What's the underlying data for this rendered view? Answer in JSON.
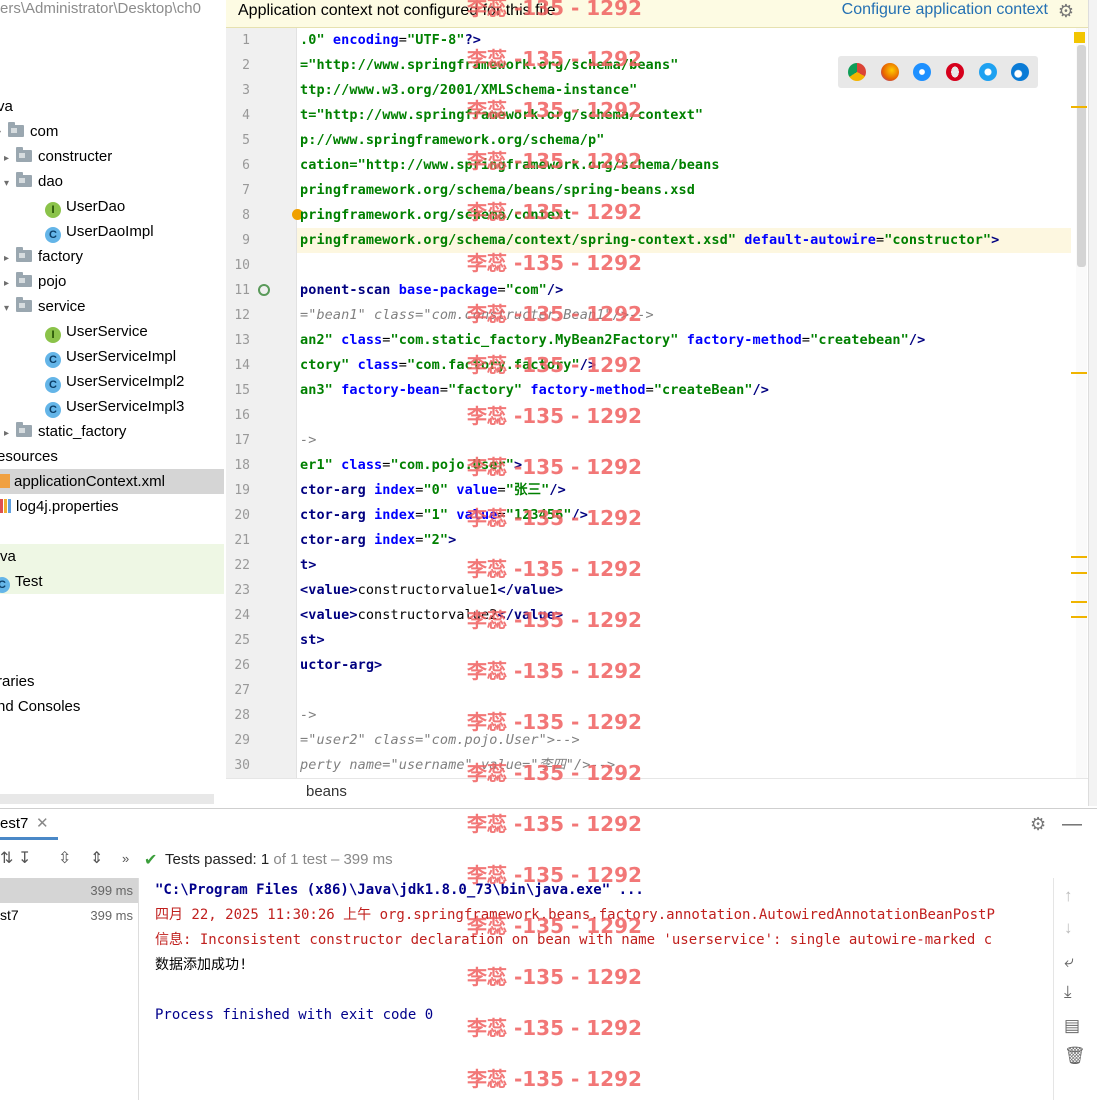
{
  "project_tree": {
    "header_path": "ers\\Administrator\\Desktop\\ch0",
    "items": [
      {
        "label": "va",
        "type": "text",
        "indent": 0
      },
      {
        "label": "com",
        "type": "folder",
        "indent": 1
      },
      {
        "label": "constructer",
        "type": "folder",
        "indent": 2
      },
      {
        "label": "dao",
        "type": "folder",
        "indent": 2
      },
      {
        "label": "UserDao",
        "type": "interface",
        "indent": 3
      },
      {
        "label": "UserDaoImpl",
        "type": "class",
        "indent": 3
      },
      {
        "label": "factory",
        "type": "folder",
        "indent": 2
      },
      {
        "label": "pojo",
        "type": "folder",
        "indent": 2
      },
      {
        "label": "service",
        "type": "folder",
        "indent": 2
      },
      {
        "label": "UserService",
        "type": "interface",
        "indent": 3
      },
      {
        "label": "UserServiceImpl",
        "type": "class",
        "indent": 3
      },
      {
        "label": "UserServiceImpl2",
        "type": "class",
        "indent": 3
      },
      {
        "label": "UserServiceImpl3",
        "type": "class",
        "indent": 3
      },
      {
        "label": "static_factory",
        "type": "folder",
        "indent": 2
      },
      {
        "label": "esources",
        "type": "text",
        "indent": 0
      },
      {
        "label": "applicationContext.xml",
        "type": "xml",
        "indent": 1
      },
      {
        "label": "log4j.properties",
        "type": "properties",
        "indent": 1
      },
      {
        "label": "",
        "type": "text",
        "indent": 0
      },
      {
        "label": "va",
        "type": "text",
        "indent": 0
      },
      {
        "label": "Test",
        "type": "testclass",
        "indent": 1
      },
      {
        "label": "",
        "type": "text",
        "indent": 0
      },
      {
        "label": "",
        "type": "text",
        "indent": 0
      },
      {
        "label": "l",
        "type": "text",
        "indent": 0
      },
      {
        "label": "raries",
        "type": "text",
        "indent": 0
      },
      {
        "label": "nd Consoles",
        "type": "text",
        "indent": 0
      }
    ]
  },
  "banner": {
    "message": "Application context not configured for this file",
    "link": "Configure application context"
  },
  "gutter": {
    "line_numbers": [
      "1",
      "2",
      "3",
      "4",
      "5",
      "6",
      "7",
      "8",
      "9",
      "10",
      "11",
      "12",
      "13",
      "14",
      "15",
      "16",
      "17",
      "18",
      "19",
      "20",
      "21",
      "22",
      "23",
      "24",
      "25",
      "26",
      "27",
      "28",
      "29",
      "30"
    ]
  },
  "code_lines": [
    [
      {
        "t": ".0\" ",
        "c": "aval"
      },
      {
        "t": "encoding",
        "c": "attr"
      },
      {
        "t": "=",
        "c": "txt"
      },
      {
        "t": "\"UTF-8\"",
        "c": "aval"
      },
      {
        "t": "?>",
        "c": "tag"
      }
    ],
    [
      {
        "t": "=\"http://www.springframework.org/schema/beans\"",
        "c": "aval"
      }
    ],
    [
      {
        "t": "ttp://www.w3.org/2001/XMLSchema-instance\"",
        "c": "aval"
      }
    ],
    [
      {
        "t": "t=\"http://www.springframework.org/schema/context\"",
        "c": "aval"
      }
    ],
    [
      {
        "t": "p://www.springframework.org/schema/p\"",
        "c": "aval"
      }
    ],
    [
      {
        "t": "cation=\"http://www.springframework.org/schema/beans",
        "c": "aval"
      }
    ],
    [
      {
        "t": "pringframework.org/schema/beans/spring-beans.xsd",
        "c": "aval"
      }
    ],
    [
      {
        "t": "pringframework.org/schema/context",
        "c": "aval"
      }
    ],
    [
      {
        "t": "pringframework.org/schema/context/spring-context.xsd\" ",
        "c": "aval"
      },
      {
        "t": "default-autowire",
        "c": "attr"
      },
      {
        "t": "=",
        "c": "txt"
      },
      {
        "t": "\"constructor\"",
        "c": "aval"
      },
      {
        "t": ">",
        "c": "tag"
      }
    ],
    [],
    [
      {
        "t": "ponent-scan ",
        "c": "tag"
      },
      {
        "t": "base-package",
        "c": "attr"
      },
      {
        "t": "=",
        "c": "txt"
      },
      {
        "t": "\"com\"",
        "c": "aval"
      },
      {
        "t": "/>",
        "c": "tag"
      }
    ],
    [
      {
        "t": "=\"bean1\" class=\"com.constructer.Bean1\"/>-->",
        "c": "cmt"
      }
    ],
    [
      {
        "t": "an2\" ",
        "c": "aval"
      },
      {
        "t": "class",
        "c": "attr"
      },
      {
        "t": "=",
        "c": "txt"
      },
      {
        "t": "\"com.static_factory.MyBean2Factory\" ",
        "c": "aval"
      },
      {
        "t": "factory-method",
        "c": "attr"
      },
      {
        "t": "=",
        "c": "txt"
      },
      {
        "t": "\"createbean\"",
        "c": "aval"
      },
      {
        "t": "/>",
        "c": "tag"
      }
    ],
    [
      {
        "t": "ctory\" ",
        "c": "aval"
      },
      {
        "t": "class",
        "c": "attr"
      },
      {
        "t": "=",
        "c": "txt"
      },
      {
        "t": "\"com.factory.factory\"",
        "c": "aval"
      },
      {
        "t": "/>",
        "c": "tag"
      }
    ],
    [
      {
        "t": "an3\" ",
        "c": "aval"
      },
      {
        "t": "factory-bean",
        "c": "attr"
      },
      {
        "t": "=",
        "c": "txt"
      },
      {
        "t": "\"factory\" ",
        "c": "aval"
      },
      {
        "t": "factory-method",
        "c": "attr"
      },
      {
        "t": "=",
        "c": "txt"
      },
      {
        "t": "\"createBean\"",
        "c": "aval"
      },
      {
        "t": "/>",
        "c": "tag"
      }
    ],
    [],
    [
      {
        "t": "->",
        "c": "cmt"
      }
    ],
    [
      {
        "t": "er1\" ",
        "c": "aval"
      },
      {
        "t": "class",
        "c": "attr"
      },
      {
        "t": "=",
        "c": "txt"
      },
      {
        "t": "\"com.pojo.User\"",
        "c": "aval"
      },
      {
        "t": ">",
        "c": "tag"
      }
    ],
    [
      {
        "t": "ctor-arg ",
        "c": "tag"
      },
      {
        "t": "index",
        "c": "attr"
      },
      {
        "t": "=",
        "c": "txt"
      },
      {
        "t": "\"0\" ",
        "c": "aval"
      },
      {
        "t": "value",
        "c": "attr"
      },
      {
        "t": "=",
        "c": "txt"
      },
      {
        "t": "\"张三\"",
        "c": "aval"
      },
      {
        "t": "/>",
        "c": "tag"
      }
    ],
    [
      {
        "t": "ctor-arg ",
        "c": "tag"
      },
      {
        "t": "index",
        "c": "attr"
      },
      {
        "t": "=",
        "c": "txt"
      },
      {
        "t": "\"1\" ",
        "c": "aval"
      },
      {
        "t": "value",
        "c": "attr"
      },
      {
        "t": "=",
        "c": "txt"
      },
      {
        "t": "\"123456\"",
        "c": "aval"
      },
      {
        "t": "/>",
        "c": "tag"
      }
    ],
    [
      {
        "t": "ctor-arg ",
        "c": "tag"
      },
      {
        "t": "index",
        "c": "attr"
      },
      {
        "t": "=",
        "c": "txt"
      },
      {
        "t": "\"2\"",
        "c": "aval"
      },
      {
        "t": ">",
        "c": "tag"
      }
    ],
    [
      {
        "t": "t>",
        "c": "tag"
      }
    ],
    [
      {
        "t": "<value>",
        "c": "tag"
      },
      {
        "t": "constructorvalue1",
        "c": "txt"
      },
      {
        "t": "</value>",
        "c": "tag"
      }
    ],
    [
      {
        "t": "<value>",
        "c": "tag"
      },
      {
        "t": "constructorvalue2",
        "c": "txt"
      },
      {
        "t": "</value>",
        "c": "tag"
      }
    ],
    [
      {
        "t": "st>",
        "c": "tag"
      }
    ],
    [
      {
        "t": "uctor-arg>",
        "c": "tag"
      }
    ],
    [],
    [
      {
        "t": "->",
        "c": "cmt"
      }
    ],
    [
      {
        "t": "=\"user2\" class=\"com.pojo.User\">-->",
        "c": "cmt"
      }
    ],
    [
      {
        "t": "perty name=\"username\" value=\"李四\"/>-->",
        "c": "cmt"
      }
    ]
  ],
  "breadcrumb": "beans",
  "run_panel": {
    "tab_label": "est7",
    "status_prefix": "Tests passed:",
    "status_count": "1",
    "status_suffix": "of 1 test – 399 ms",
    "tests": [
      {
        "name": "",
        "duration": "399 ms"
      },
      {
        "name": "st7",
        "duration": "399 ms"
      }
    ],
    "console_lines": [
      {
        "text": "\"C:\\Program Files (x86)\\Java\\jdk1.8.0_73\\bin\\java.exe\" ...",
        "color": "#00008b",
        "bold": true
      },
      {
        "text": "四月 22, 2025 11:30:26 上午 org.springframework.beans.factory.annotation.AutowiredAnnotationBeanPostP",
        "color": "#c0201e",
        "bold": false
      },
      {
        "text": "信息: Inconsistent constructor declaration on bean with name 'userservice': single autowire-marked c",
        "color": "#c0201e",
        "bold": false
      },
      {
        "text": "数据添加成功!",
        "color": "#000000",
        "bold": false
      },
      {
        "text": "",
        "color": "#000000",
        "bold": false
      },
      {
        "text": "Process finished with exit code 0",
        "color": "#00008b",
        "bold": false
      }
    ]
  },
  "watermark": "李蕊 -135 - 1292",
  "colors": {
    "accent": "#2470b3",
    "passed": "#3b9e3b",
    "warning": "#f2c500"
  }
}
